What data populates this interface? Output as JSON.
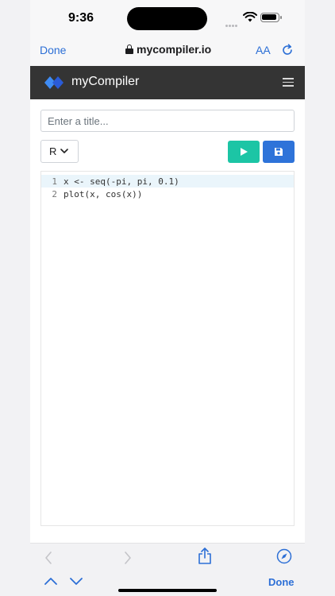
{
  "status_bar": {
    "time": "9:36"
  },
  "browser": {
    "done_label": "Done",
    "url": "mycompiler.io",
    "text_size_label": "AA"
  },
  "app": {
    "brand": "myCompiler",
    "title_placeholder": "Enter a title...",
    "language": "R"
  },
  "editor": {
    "lines": [
      {
        "num": "1",
        "code": "x <- seq(-pi, pi, 0.1)"
      },
      {
        "num": "2",
        "code": "plot(x, cos(x))"
      }
    ]
  },
  "keyboard_bar": {
    "done_label": "Done"
  },
  "colors": {
    "accent": "#2c6fd6",
    "run_button": "#1cc5a5",
    "save_button": "#2e73d9",
    "navbar": "#343434"
  }
}
